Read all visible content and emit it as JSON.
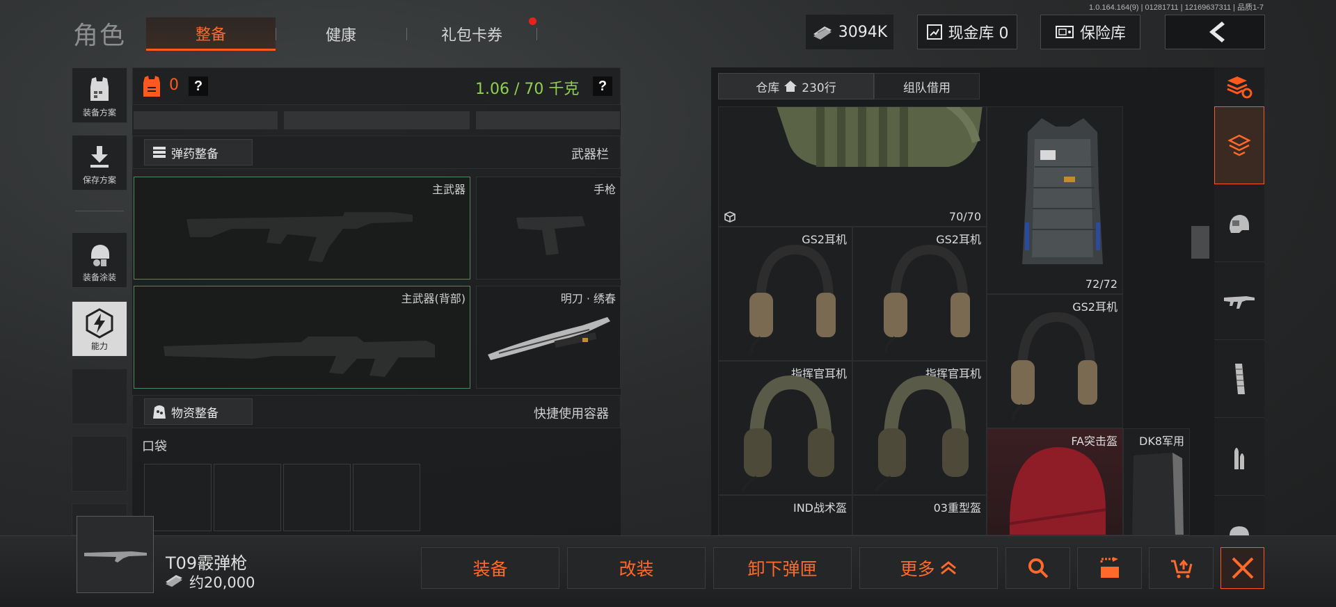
{
  "version": "1.0.164.164(9) | 01281711 | 12169637311 | 品质1-7",
  "page_title": "角色",
  "tabs": [
    {
      "label": "整备",
      "active": true
    },
    {
      "label": "健康",
      "active": false
    },
    {
      "label": "礼包卡券",
      "active": false,
      "has_notification": true
    }
  ],
  "currency": {
    "amount": "3094K"
  },
  "cash_vault": {
    "label": "现金库 0"
  },
  "safe_box": {
    "label": "保险库"
  },
  "sidebar": [
    {
      "label": "装备方案"
    },
    {
      "label": "保存方案"
    },
    {
      "label": "装备涂装"
    },
    {
      "label": "能力"
    }
  ],
  "loadout": {
    "armor_value": "0",
    "weight": "1.06 / 70 千克",
    "ammo_button": "弹药整备",
    "weapon_bar": "武器栏",
    "primary_weapon": "主武器",
    "pistol": "手枪",
    "primary_weapon_back": "主武器(背部)",
    "melee": "明刀 · 绣春",
    "supply_button": "物资整备",
    "quick_container": "快捷使用容器",
    "pocket": "口袋"
  },
  "warehouse": {
    "tab_storage": "仓库",
    "rows": "230行",
    "tab_borrow": "组队借用",
    "items": [
      {
        "name": "",
        "count": "70/70"
      },
      {
        "name": "",
        "count": "72/72"
      },
      {
        "name": "GS2耳机"
      },
      {
        "name": "GS2耳机"
      },
      {
        "name": "GS2耳机"
      },
      {
        "name": "指挥官耳机"
      },
      {
        "name": "指挥官耳机"
      },
      {
        "name": "FA突击盔"
      },
      {
        "name": "DK8军用"
      },
      {
        "name": "IND战术盔"
      },
      {
        "name": "03重型盔"
      }
    ]
  },
  "selected_item": {
    "name": "T09霰弹枪",
    "price": "约20,000"
  },
  "actions": [
    {
      "label": "装备"
    },
    {
      "label": "改装"
    },
    {
      "label": "卸下弹匣"
    },
    {
      "label": "更多"
    }
  ],
  "colors": {
    "accent": "#ff5a1e",
    "weight_green": "#8fd14f",
    "selected_slot": "#4f8a5c"
  }
}
